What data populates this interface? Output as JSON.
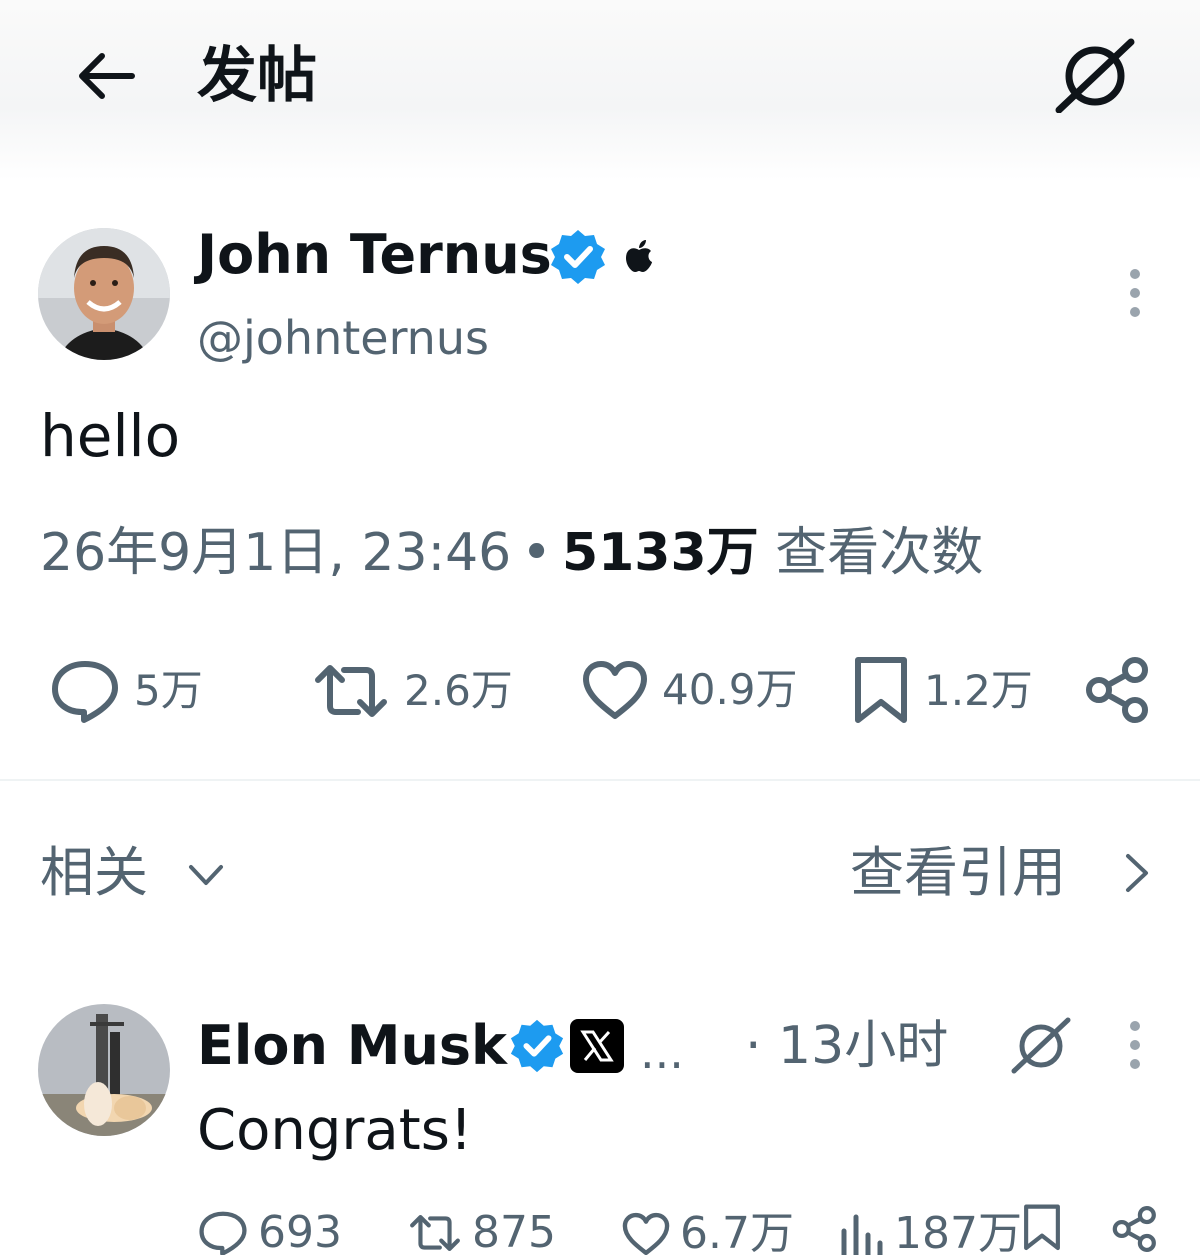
{
  "header": {
    "title": "发帖",
    "back_icon": "arrow-left-icon",
    "grok_icon": "grok-icon"
  },
  "post": {
    "author": {
      "display_name": "John Ternus",
      "handle": "@johnternus",
      "verified": true,
      "affiliate_icon": "apple-logo-icon"
    },
    "text": "hello",
    "timestamp": "26年9月1日, 23:46",
    "views_count": "5133万",
    "views_label": "查看次数",
    "actions": {
      "replies": "5万",
      "reposts": "2.6万",
      "likes": "40.9万",
      "bookmarks": "1.2万"
    }
  },
  "section": {
    "related_label": "相关",
    "view_quotes_label": "查看引用"
  },
  "reply": {
    "author": {
      "display_name": "Elon Musk",
      "verified": true,
      "affiliate_icon": "x-logo-icon",
      "truncation": "..."
    },
    "time": "· 13小时",
    "text": "Congrats!",
    "actions": {
      "replies": "693",
      "reposts": "875",
      "likes": "6.7万",
      "views": "187万"
    }
  },
  "colors": {
    "text_primary": "#0f1419",
    "text_secondary": "#536471",
    "verified_blue": "#1d9bf0",
    "divider": "#eff3f4"
  }
}
